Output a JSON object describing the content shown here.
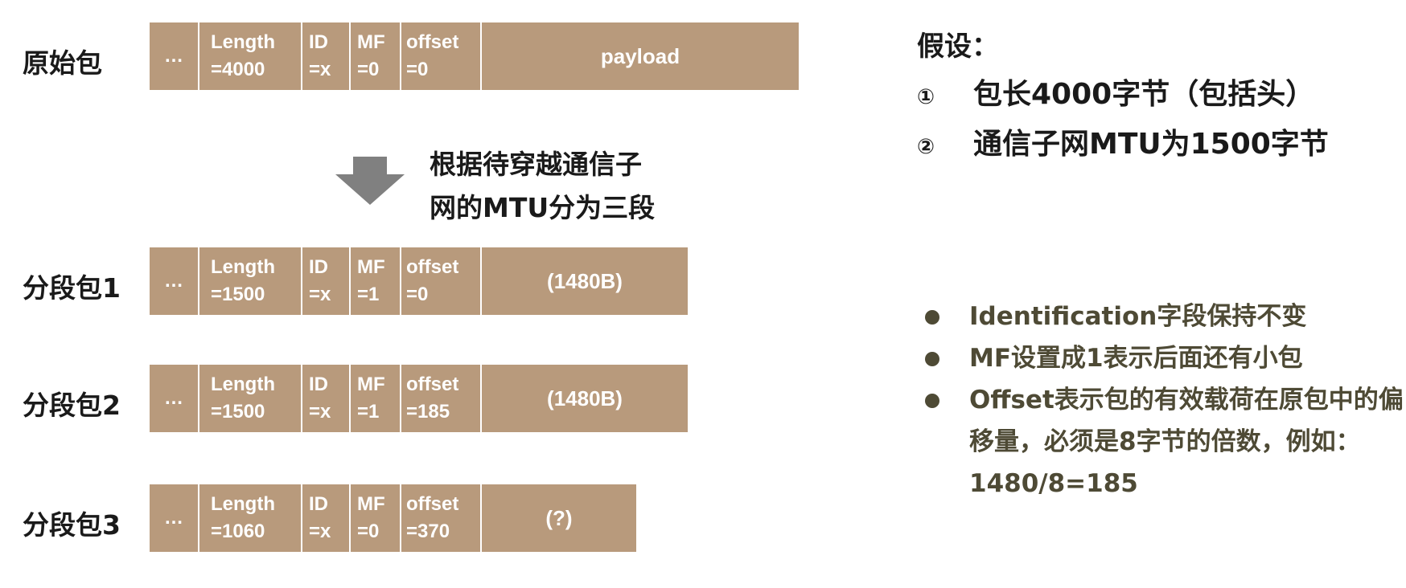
{
  "original": {
    "label": "原始包",
    "fields": {
      "dots": "…",
      "len1": "Length",
      "len2": "=4000",
      "id1": "ID",
      "id2": "=x",
      "mf1": "MF",
      "mf2": "=0",
      "off1": "offset",
      "off2": "=0",
      "payload": "payload"
    }
  },
  "arrow_text": {
    "line1": "根据待穿越通信子",
    "line2": "网的MTU分为三段"
  },
  "fragments": [
    {
      "label": "分段包1",
      "dots": "…",
      "len1": "Length",
      "len2": "=1500",
      "id1": "ID",
      "id2": "=x",
      "mf1": "MF",
      "mf2": "=1",
      "off1": "offset",
      "off2": "=0",
      "payload": "(1480B)"
    },
    {
      "label": "分段包2",
      "dots": "…",
      "len1": "Length",
      "len2": "=1500",
      "id1": "ID",
      "id2": "=x",
      "mf1": "MF",
      "mf2": "=1",
      "off1": "offset",
      "off2": "=185",
      "payload": "(1480B)"
    },
    {
      "label": "分段包3",
      "dots": "…",
      "len1": "Length",
      "len2": "=1060",
      "id1": "ID",
      "id2": "=x",
      "mf1": "MF",
      "mf2": "=0",
      "off1": "offset",
      "off2": "=370",
      "payload": "(?)"
    }
  ],
  "assumptions": {
    "title": "假设：",
    "items": [
      {
        "num": "①",
        "text": "包长4000字节（包括头）"
      },
      {
        "num": "②",
        "text": "通信子网MTU为1500字节"
      }
    ]
  },
  "notes": [
    "Identification字段保持不变",
    "MF设置成1表示后面还有小包",
    "Offset表示包的有效载荷在原包中的偏移量，必须是8字节的倍数，例如：1480/8=185"
  ],
  "colors": {
    "packet_fill": "#b89a7c",
    "arrow": "#808080",
    "note_text": "#4e4a35"
  }
}
